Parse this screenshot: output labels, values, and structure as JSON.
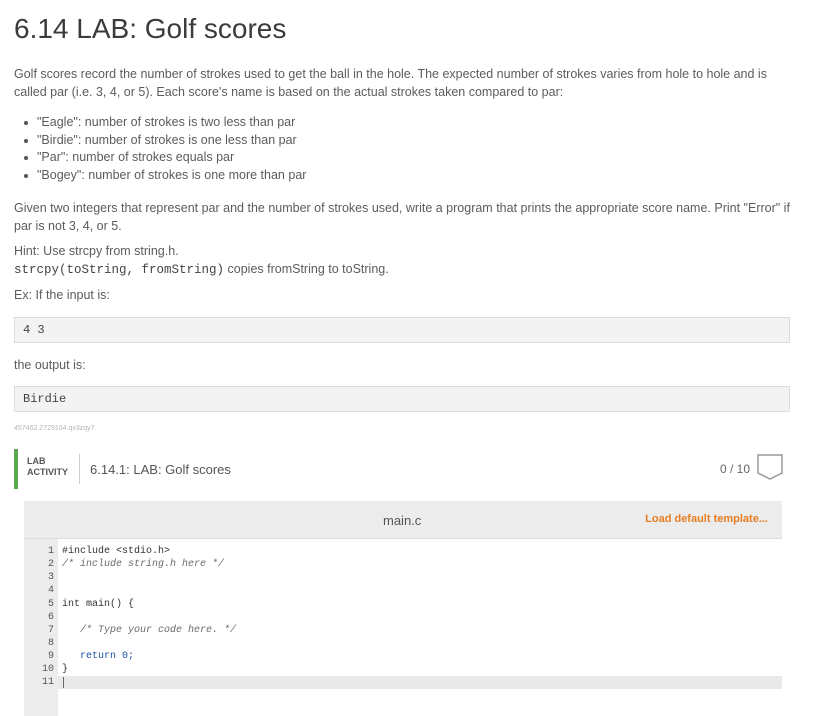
{
  "title": "6.14 LAB: Golf scores",
  "intro": "Golf scores record the number of strokes used to get the ball in the hole. The expected number of strokes varies from hole to hole and is called par (i.e. 3, 4, or 5). Each score's name is based on the actual strokes taken compared to par:",
  "bullets": [
    "\"Eagle\": number of strokes is two less than par",
    "\"Birdie\": number of strokes is one less than par",
    "\"Par\": number of strokes equals par",
    "\"Bogey\": number of strokes is one more than par"
  ],
  "task": "Given two integers that represent par and the number of strokes used, write a program that prints the appropriate score name. Print \"Error\" if par is not 3, 4, or 5.",
  "hint": "Hint: Use strcpy from string.h.",
  "hint_code": "strcpy(toString, fromString)",
  "hint_rest": " copies fromString to toString.",
  "example_intro": "Ex: If the input is:",
  "example_input": "4 3",
  "output_intro": "the output is:",
  "example_output": "Birdie",
  "problem_id": "457462.2729104.qx3zqy7",
  "lab": {
    "label_line1": "LAB",
    "label_line2": "ACTIVITY",
    "name": "6.14.1: LAB: Golf scores",
    "score": "0 / 10"
  },
  "editor": {
    "file_name": "main.c",
    "load_default": "Load default template...",
    "lines": [
      {
        "num": "1",
        "text": "#include <stdio.h>",
        "kind": "plain"
      },
      {
        "num": "2",
        "text": "/* include string.h here */",
        "kind": "comment"
      },
      {
        "num": "3",
        "text": "",
        "kind": "plain"
      },
      {
        "num": "4",
        "text": "",
        "kind": "plain"
      },
      {
        "num": "5",
        "text": "int main() {",
        "kind": "plain"
      },
      {
        "num": "6",
        "text": "",
        "kind": "plain"
      },
      {
        "num": "7",
        "text": "   /* Type your code here. */",
        "kind": "comment"
      },
      {
        "num": "8",
        "text": "",
        "kind": "plain"
      },
      {
        "num": "9",
        "text": "   return 0;",
        "kind": "keyword"
      },
      {
        "num": "10",
        "text": "}",
        "kind": "plain"
      },
      {
        "num": "11",
        "text": "",
        "kind": "plain"
      }
    ]
  },
  "colors": {
    "accent_green": "#5aa74f",
    "load_orange": "#e67e22"
  }
}
